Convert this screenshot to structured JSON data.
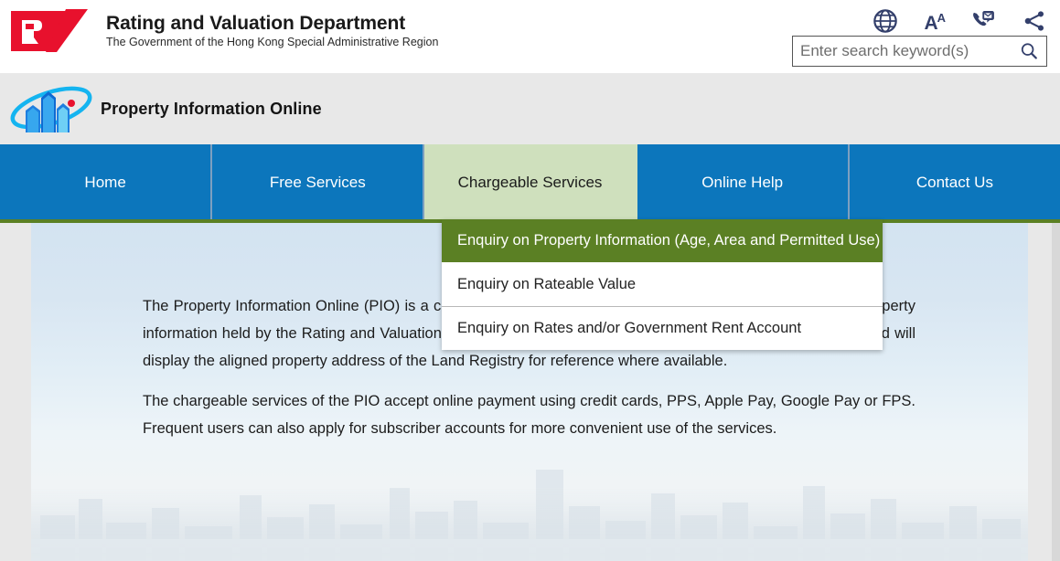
{
  "header": {
    "logo_alt": "rv-logo",
    "department_title": "Rating and Valuation Department",
    "government_line": "The Government of the Hong Kong Special Administrative Region",
    "utility_icons": [
      {
        "name": "globe-icon",
        "label": "Language"
      },
      {
        "name": "font-size-icon",
        "label": "AA"
      },
      {
        "name": "contact-icon",
        "label": "Contact"
      },
      {
        "name": "share-icon",
        "label": "Share"
      }
    ],
    "font_size_label": "A",
    "font_size_sup": "A",
    "search": {
      "placeholder": "Enter search keyword(s)",
      "value": "",
      "button_name": "search-icon"
    }
  },
  "banner": {
    "logo_alt": "property-information-online-logo",
    "title": "Property Information Online"
  },
  "nav": {
    "items": [
      {
        "label": "Home",
        "active": false
      },
      {
        "label": "Free Services",
        "active": false
      },
      {
        "label": "Chargeable Services",
        "active": true
      },
      {
        "label": "Online Help",
        "active": false
      },
      {
        "label": "Contact Us",
        "active": false
      }
    ],
    "active_accent_color": "#cfe0bd",
    "bar_color": "#0c76bc",
    "underline_color": "#5b8024"
  },
  "dropdown": {
    "parent": "Chargeable Services",
    "items": [
      {
        "label": "Enquiry on Property Information (Age, Area and Permitted Use)",
        "highlighted": true
      },
      {
        "label": "Enquiry on Rateable Value",
        "highlighted": false
      },
      {
        "label": "Enquiry on Rates and/or Government Rent Account",
        "highlighted": false
      }
    ],
    "highlight_color": "#5b8024"
  },
  "main": {
    "paragraphs": [
      "The Property Information Online (PIO) is a chargeable service which enables users to conveniently obtain property information held by the Rating and Valuation Department through an online search engine.  The property record will display the aligned property address of the Land Registry for reference where available.",
      "The chargeable services of the PIO accept online payment using credit cards, PPS, Apple Pay, Google Pay or FPS.  Frequent users can also apply for subscriber accounts for more convenient use of the services."
    ]
  }
}
